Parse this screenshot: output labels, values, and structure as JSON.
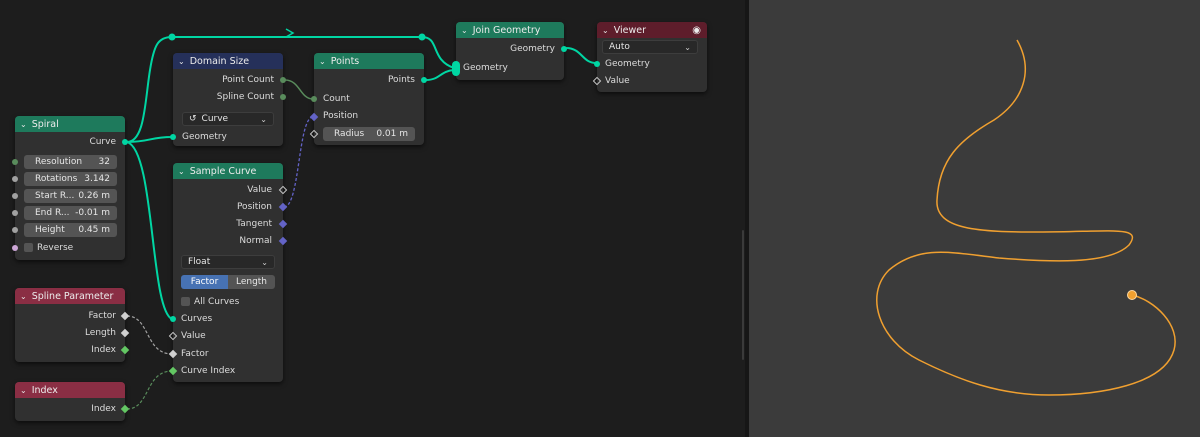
{
  "nodes": {
    "spiral": {
      "title": "Spiral",
      "output_curve": "Curve",
      "fields": [
        {
          "label": "Resolution",
          "value": "32"
        },
        {
          "label": "Rotations",
          "value": "3.142"
        },
        {
          "label": "Start R...",
          "value": "0.26 m"
        },
        {
          "label": "End R...",
          "value": "-0.01 m"
        },
        {
          "label": "Height",
          "value": "0.45 m"
        }
      ],
      "reverse_label": "Reverse"
    },
    "domain_size": {
      "title": "Domain Size",
      "point_count": "Point Count",
      "spline_count": "Spline Count",
      "component": "Curve",
      "geometry": "Geometry"
    },
    "points": {
      "title": "Points",
      "output_points": "Points",
      "count": "Count",
      "position": "Position",
      "radius_label": "Radius",
      "radius_value": "0.01 m"
    },
    "join_geometry": {
      "title": "Join Geometry",
      "output_geometry": "Geometry",
      "input_geometry": "Geometry"
    },
    "viewer": {
      "title": "Viewer",
      "domain": "Auto",
      "geometry": "Geometry",
      "value": "Value"
    },
    "sample_curve": {
      "title": "Sample Curve",
      "outputs": [
        "Value",
        "Position",
        "Tangent",
        "Normal"
      ],
      "data_type": "Float",
      "mode_factor": "Factor",
      "mode_length": "Length",
      "all_curves": "All Curves",
      "inputs": [
        "Curves",
        "Value",
        "Factor",
        "Curve Index"
      ]
    },
    "spline_parameter": {
      "title": "Spline Parameter",
      "outputs": [
        "Factor",
        "Length",
        "Index"
      ]
    },
    "index": {
      "title": "Index",
      "output": "Index"
    }
  },
  "colors": {
    "geometry_socket": "#00d6a3",
    "vector_socket": "#6363c7",
    "header_geometry": "#1e7a5c",
    "header_input": "#8a2e44",
    "header_output": "#5e1d2b",
    "header_utility": "#25305a",
    "curve_preview": "#f0a030",
    "selection_active": "#4772b3"
  },
  "icons": {
    "collapse": "chevron-down-icon",
    "viewer_eye": "eye-icon",
    "curve_domain": "curve-icon"
  }
}
